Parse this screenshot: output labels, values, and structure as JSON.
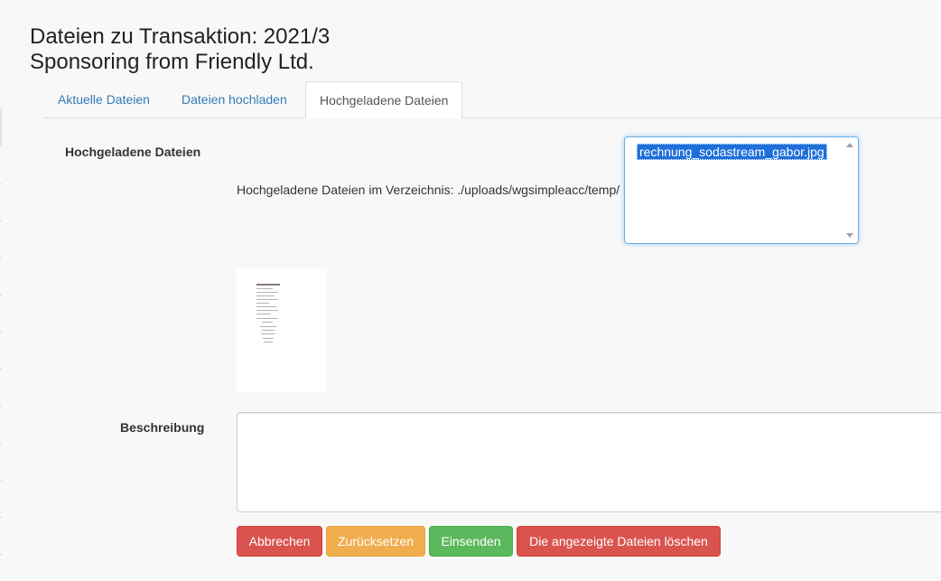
{
  "page": {
    "title_line1": "Dateien zu Transaktion: 2021/3",
    "title_line2": "Sponsoring from Friendly Ltd."
  },
  "tabs": [
    {
      "label": "Aktuelle Dateien",
      "active": false
    },
    {
      "label": "Dateien hochladen",
      "active": false
    },
    {
      "label": "Hochgeladene Dateien",
      "active": true
    }
  ],
  "uploaded": {
    "label": "Hochgeladene Dateien",
    "directory_text": "Hochgeladene Dateien im Verzeichnis: ./uploads/wgsimpleacc/temp/",
    "files": [
      "rechnung_sodastream_gabor.jpg"
    ],
    "selected_file": "rechnung_sodastream_gabor.jpg"
  },
  "description": {
    "label": "Beschreibung",
    "value": ""
  },
  "buttons": {
    "cancel": "Abbrechen",
    "reset": "Zurücksetzen",
    "submit": "Einsenden",
    "delete": "Die angezeigte Dateien löschen"
  },
  "colors": {
    "link": "#337ab7",
    "danger": "#d9534f",
    "warning": "#f0ad4e",
    "success": "#5cb85c",
    "selection": "#1e6fd9",
    "focus_border": "#66afe9"
  }
}
